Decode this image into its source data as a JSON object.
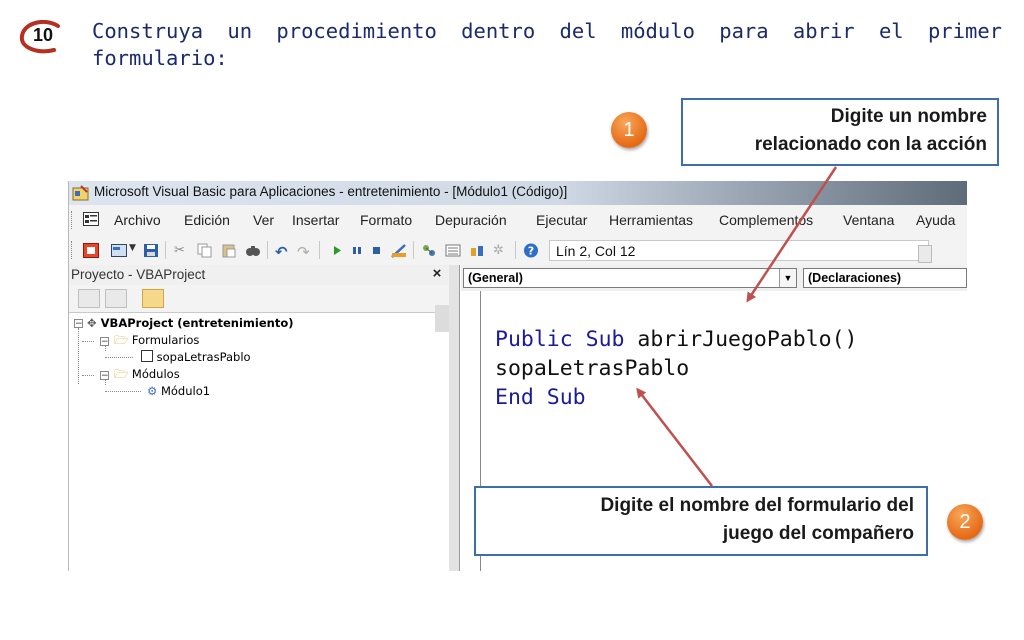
{
  "step_number": "10",
  "instruction": "Construya un procedimiento dentro del módulo para abrir el primer formulario:",
  "callout_1": {
    "number": "1",
    "line1": "Digite un nombre",
    "line2": "relacionado con la acción"
  },
  "callout_2": {
    "number": "2",
    "line1": "Digite el nombre del formulario del",
    "line2": "juego del compañero"
  },
  "window": {
    "title": "Microsoft Visual Basic para Aplicaciones - entretenimiento - [Módulo1 (Código)]",
    "menu": [
      "Archivo",
      "Edición",
      "Ver",
      "Insertar",
      "Formato",
      "Depuración",
      "Ejecutar",
      "Herramientas",
      "Complementos",
      "Ventana",
      "Ayuda"
    ],
    "status_position": "Lín 2, Col 12"
  },
  "project_pane": {
    "title": "Proyecto - VBAProject",
    "close": "×",
    "tree": {
      "root": "VBAProject (entretenimiento)",
      "forms_folder": "Formularios",
      "form_item": "sopaLetrasPablo",
      "modules_folder": "Módulos",
      "module_item": "Módulo1"
    }
  },
  "code_pane": {
    "object_combo": "(General)",
    "procedure_combo": "(Declaraciones)",
    "line1_keyword1": "Public",
    "line1_keyword2": "Sub",
    "line1_name": "abrirJuegoPablo()",
    "line2": "sopaLetrasPablo",
    "line3_keyword1": "End",
    "line3_keyword2": "Sub"
  },
  "colors": {
    "accent_orange": "#e66a15",
    "callout_border": "#3b6fa6",
    "arrow": "#c0504d",
    "keyword_blue": "#1a1a9a",
    "instruction_text": "#1a2a6c"
  }
}
